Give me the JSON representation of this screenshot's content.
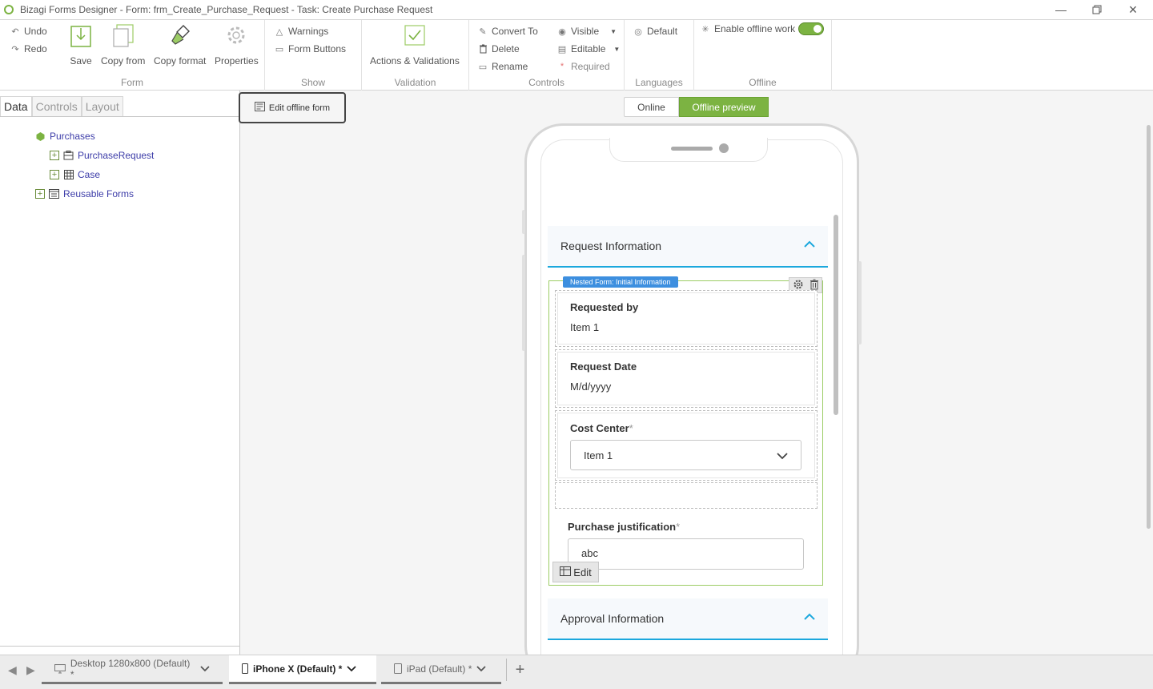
{
  "window": {
    "title": "Bizagi Forms Designer  - Form: frm_Create_Purchase_Request - Task:  Create Purchase Request"
  },
  "ribbon": {
    "form_group": {
      "label": "Form",
      "undo": "Undo",
      "redo": "Redo",
      "save": "Save",
      "copy_from": "Copy from",
      "copy_format": "Copy format",
      "properties": "Properties"
    },
    "show_group": {
      "label": "Show",
      "warnings": "Warnings",
      "form_buttons": "Form Buttons"
    },
    "validation_group": {
      "label": "Validation",
      "actions": "Actions & Validations"
    },
    "controls_group": {
      "label": "Controls",
      "convert_to": "Convert To",
      "delete": "Delete",
      "rename": "Rename",
      "visible": "Visible",
      "editable": "Editable",
      "required": "Required"
    },
    "languages_group": {
      "label": "Languages",
      "default": "Default"
    },
    "offline_group": {
      "label": "Offline",
      "enable_offline": "Enable offline work",
      "enable_offline_on": true
    }
  },
  "left_panel": {
    "tabs": [
      "Data",
      "Controls",
      "Layout"
    ],
    "active_tab": "Data",
    "tree": {
      "root": "Purchases",
      "children": [
        "PurchaseRequest",
        "Case"
      ],
      "reusable": "Reusable Forms"
    }
  },
  "canvas": {
    "edit_offline_label": "Edit offline form",
    "mode_online": "Online",
    "mode_offline": "Offline preview",
    "accent": "#7cb342"
  },
  "form": {
    "section1_title": "Request Information",
    "nested_label": "Nested Form: Initial Information",
    "requested_by_label": "Requested by",
    "requested_by_value": "Item 1",
    "request_date_label": "Request Date",
    "request_date_value": "M/d/yyyy",
    "cost_center_label": "Cost Center",
    "cost_center_value": "Item 1",
    "justification_label": "Purchase justification",
    "justification_value": "abc",
    "required_mark": "*",
    "edit_label": "Edit",
    "section2_title": "Approval Information",
    "section_accent": "#1ca8dd"
  },
  "devices": {
    "desktop": "Desktop 1280x800 (Default) *",
    "iphone": "iPhone X (Default) *",
    "ipad": "iPad (Default) *"
  }
}
